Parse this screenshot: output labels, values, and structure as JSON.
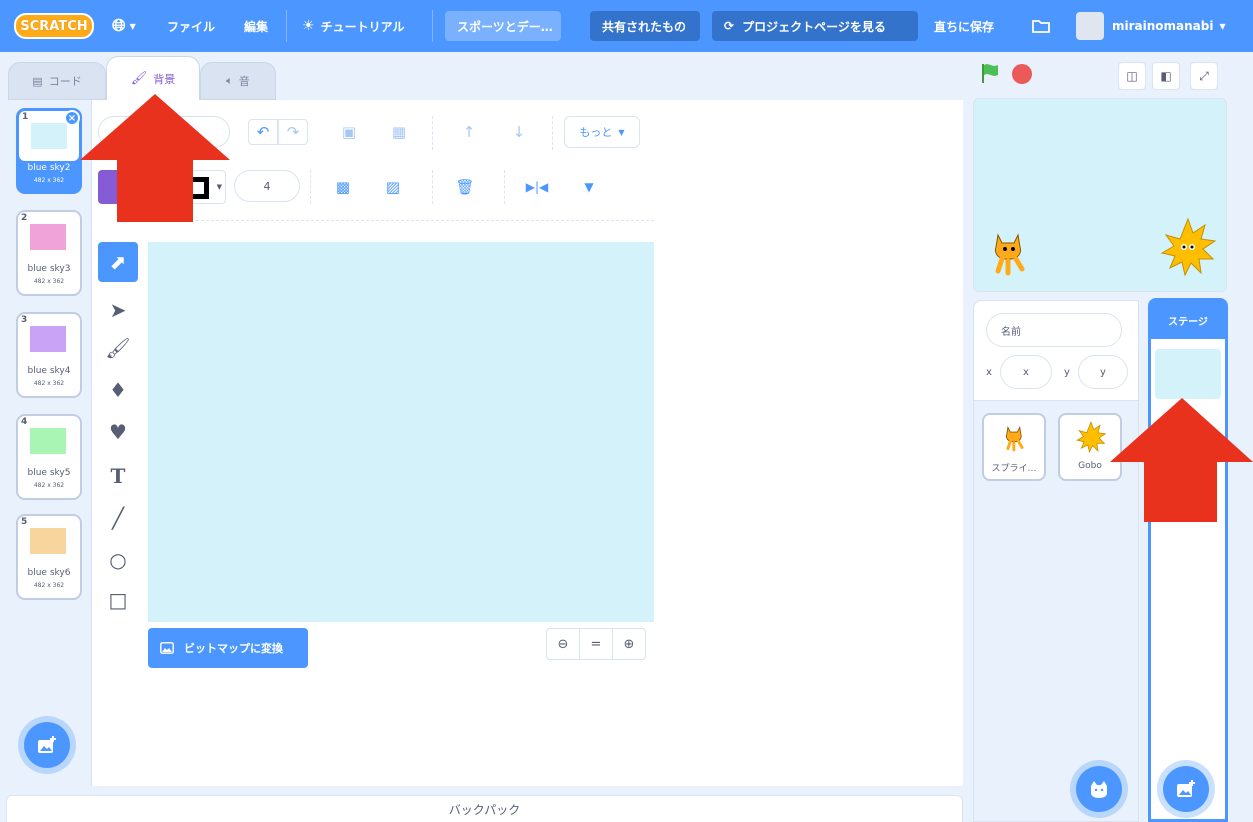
{
  "menu": {
    "logo": "SCRATCH",
    "file": "ファイル",
    "edit": "編集",
    "tutorial": "チュートリアル",
    "project_title": "スポーツとデー…",
    "shared": "共有されたもの",
    "project_page": "プロジェクトページを見る",
    "save_now": "直ちに保存",
    "username": "mirainomanabi"
  },
  "tabs": {
    "code": "コード",
    "backdrops": "背景",
    "sounds": "音"
  },
  "costumes": [
    {
      "num": "1",
      "name": "blue sky2",
      "size": "482 x 362",
      "color": "#d3f2fa"
    },
    {
      "num": "2",
      "name": "blue sky3",
      "size": "482 x 362",
      "color": "#f0a3d8"
    },
    {
      "num": "3",
      "name": "blue sky4",
      "size": "482 x 362",
      "color": "#c9a3f5"
    },
    {
      "num": "4",
      "name": "blue sky5",
      "size": "482 x 362",
      "color": "#a9f5b3"
    },
    {
      "num": "5",
      "name": "blue sky6",
      "size": "482 x 362",
      "color": "#f7d59c"
    }
  ],
  "editor": {
    "more_label": "もっと",
    "outline_size": "4",
    "convert_bitmap": "ビットマップに変換",
    "zoom_reset": "="
  },
  "backpack": "バックパック",
  "sprite_info": {
    "name_placeholder": "名前",
    "x_label": "x",
    "x_placeholder": "x",
    "y_label": "y",
    "y_placeholder": "y"
  },
  "sprites": [
    {
      "name": "スプライ…"
    },
    {
      "name": "Gobo"
    }
  ],
  "stage_pane": {
    "header": "ステージ"
  },
  "colors": {
    "accent": "#4c97ff",
    "stage_bg": "#d3f2fa",
    "fill_color": "#855cd6",
    "arrow": "#e8321e"
  }
}
